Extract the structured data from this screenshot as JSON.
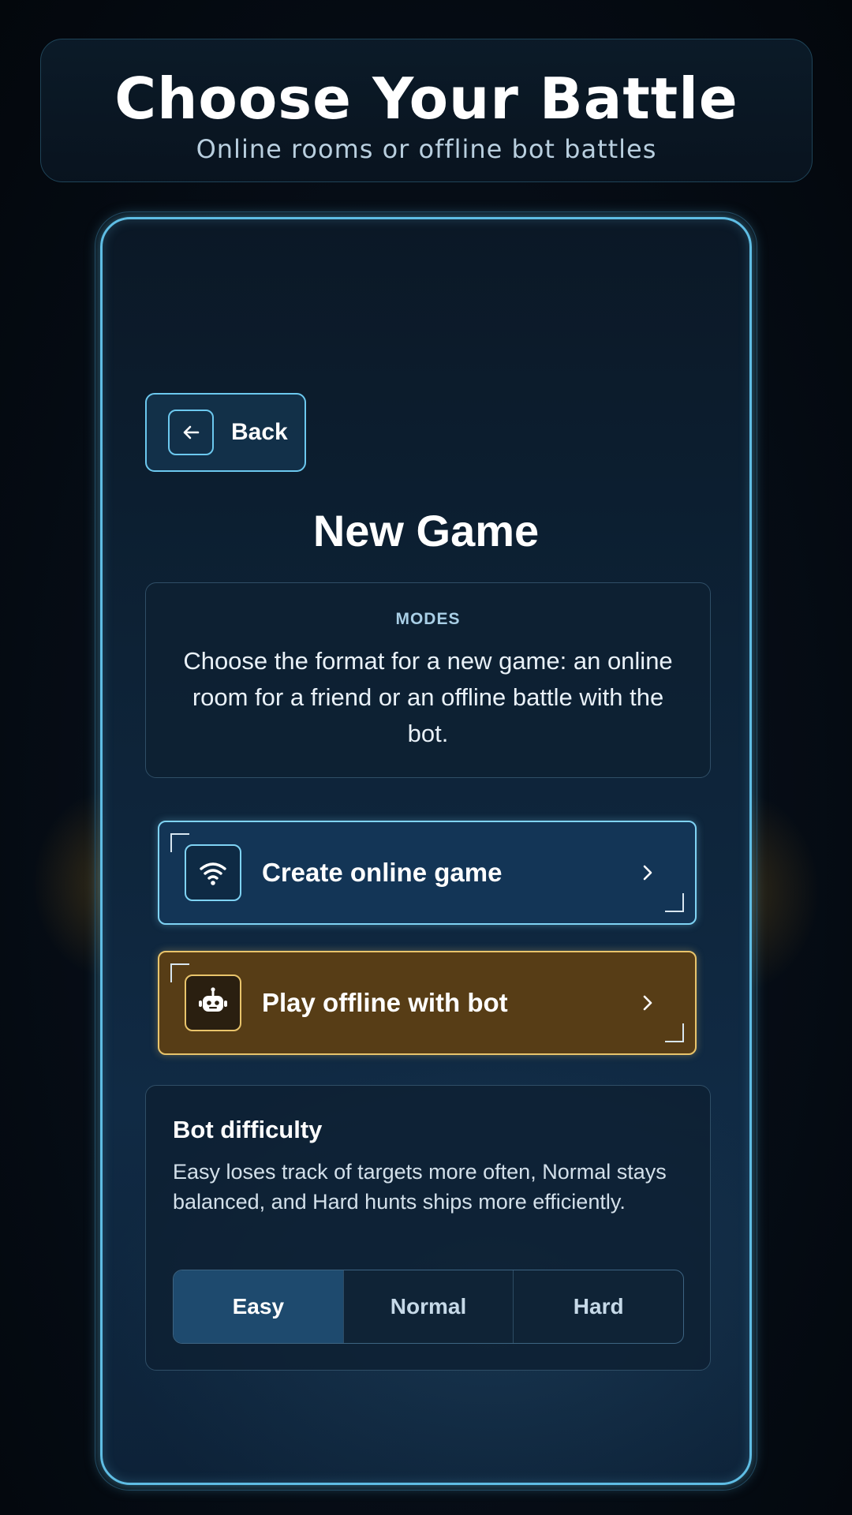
{
  "header": {
    "title": "Choose Your Battle",
    "subtitle": "Online rooms or offline bot battles"
  },
  "nav": {
    "back_label": "Back"
  },
  "page": {
    "title": "New Game"
  },
  "modes_card": {
    "label": "MODES",
    "description": "Choose the format for a new game: an online room for a friend or an offline battle with the bot."
  },
  "mode_buttons": [
    {
      "label": "Create online game",
      "icon": "wifi-icon"
    },
    {
      "label": "Play offline with bot",
      "icon": "robot-icon"
    }
  ],
  "difficulty": {
    "title": "Bot difficulty",
    "description": "Easy loses track of targets more often, Normal stays balanced, and Hard hunts ships more efficiently.",
    "options": [
      "Easy",
      "Normal",
      "Hard"
    ],
    "selected": "Easy"
  },
  "colors": {
    "accent_blue": "#6cc8ee",
    "accent_gold": "#e9c46b",
    "online_bg": "#133556",
    "offline_bg": "#573d16",
    "selected_segment": "#1e4a6e"
  }
}
